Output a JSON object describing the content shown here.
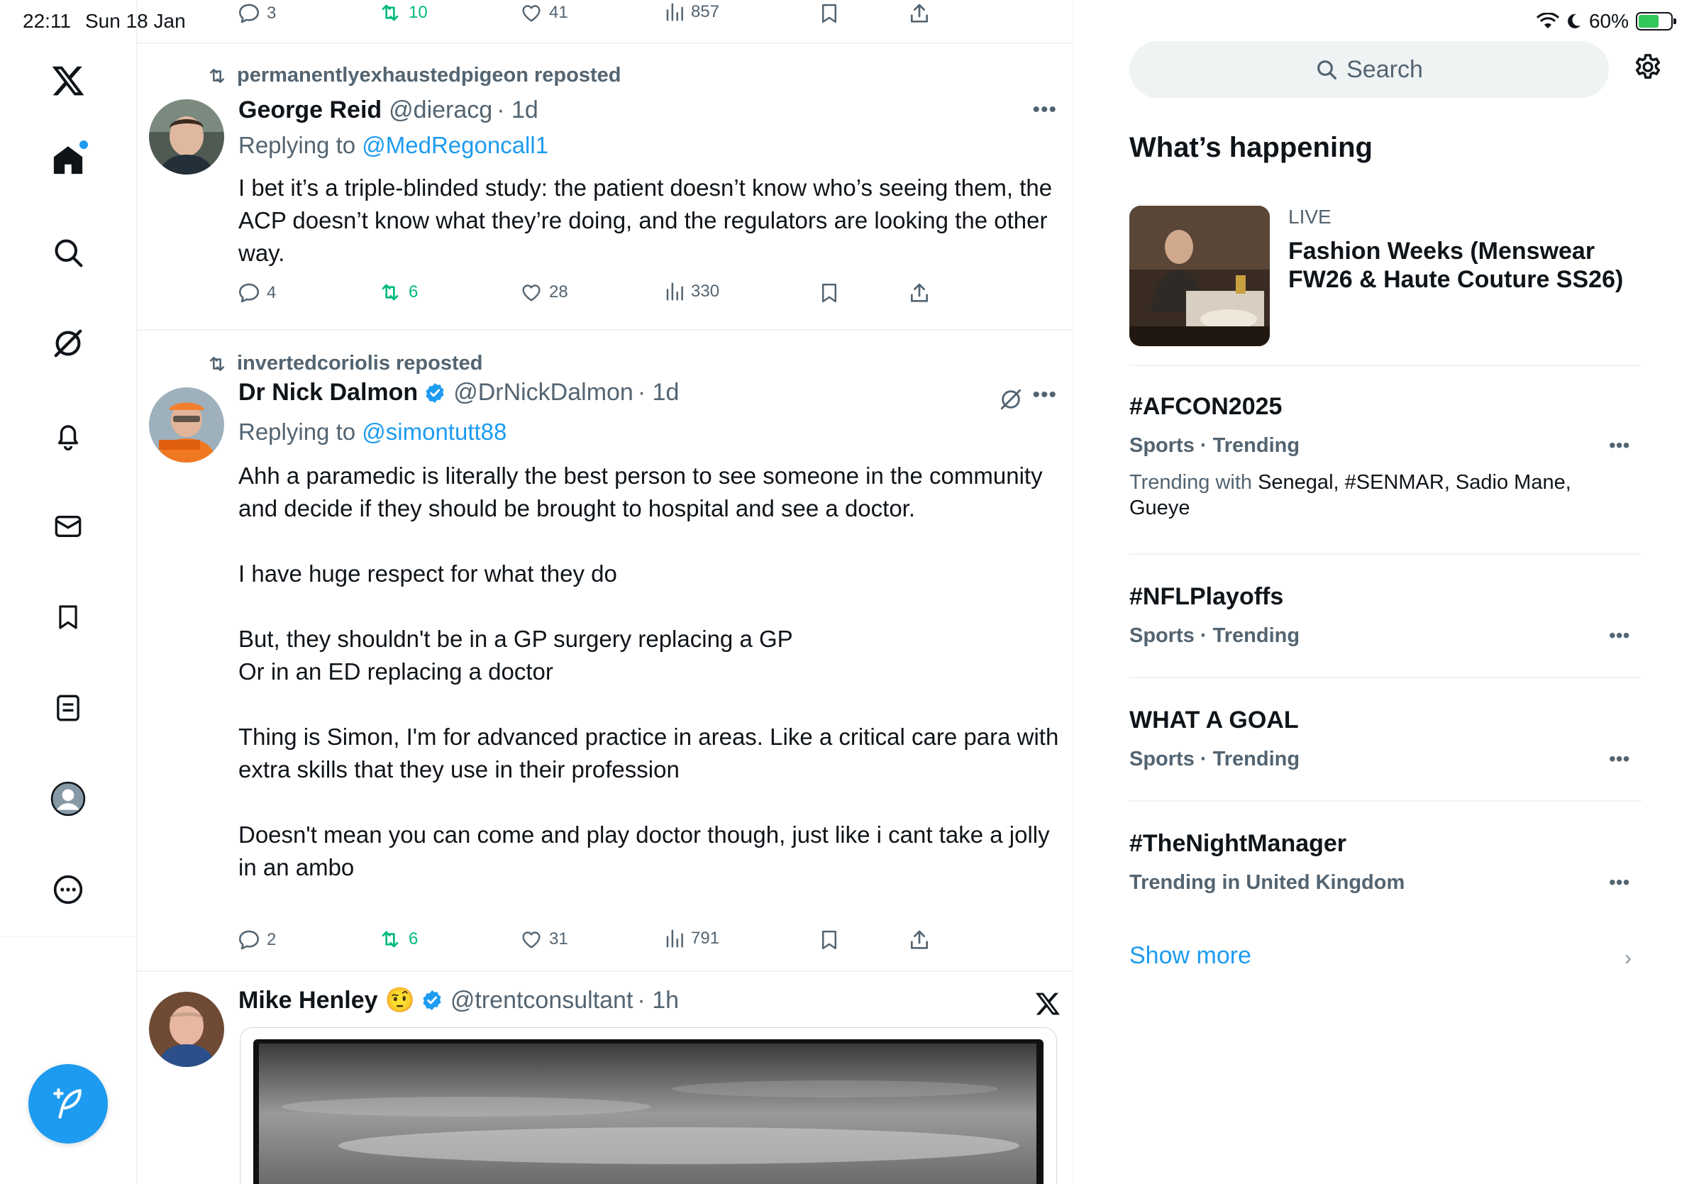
{
  "status_bar": {
    "time": "22:11",
    "date": "Sun 18 Jan",
    "battery": "60%",
    "battery_level": 0.6
  },
  "nav": {
    "items": [
      "x-logo",
      "home",
      "explore",
      "grok",
      "notifications",
      "messages",
      "bookmarks",
      "lists",
      "profile",
      "more"
    ],
    "compose": "compose"
  },
  "feed": {
    "top_tweet_actions": {
      "replies": "3",
      "reposts": "10",
      "likes": "41",
      "views": "857"
    },
    "tweets": [
      {
        "repost_by": "permanentlyexhaustedpigeon reposted",
        "name": "George Reid",
        "handle": "@dieracg",
        "time": "· 1d",
        "replying_prefix": "Replying to ",
        "replying_to": "@MedRegoncall1",
        "text": "I bet it’s a triple-blinded study: the patient doesn’t know who’s seeing them, the ACP doesn’t know what they’re doing, and the regulators are looking the other way.",
        "replies": "4",
        "reposts": "6",
        "likes": "28",
        "views": "330"
      },
      {
        "repost_by": "invertedcoriolis reposted",
        "name": "Dr Nick Dalmon",
        "handle": "@DrNickDalmon",
        "time": "· 1d",
        "replying_prefix": "Replying to ",
        "replying_to": "@simontutt88",
        "text": "Ahh a paramedic is literally the best person to see someone in the community and decide if they should be brought to hospital and see a doctor.\n\nI have huge respect for what they do\n\nBut, they shouldn't be in a GP surgery replacing a GP\nOr in an ED replacing a doctor\n\nThing is Simon, I'm for advanced practice in areas. Like a critical care para with extra skills that they use in their profession\n\nDoesn't mean you can come and play doctor though, just like i cant take a jolly in an ambo",
        "replies": "2",
        "reposts": "6",
        "likes": "31",
        "views": "791"
      },
      {
        "name": "Mike Henley",
        "emoji": "🤨",
        "handle": "@trentconsultant",
        "time": "· 1h"
      }
    ]
  },
  "sidebar": {
    "search_placeholder": "Search",
    "whats_happening": "What’s happening",
    "live": {
      "label": "LIVE",
      "title": "Fashion Weeks (Menswear FW26 & Haute Couture SS26)"
    },
    "trends": [
      {
        "name": "#AFCON2025",
        "meta": "Sports · Trending",
        "with_label": "Trending with ",
        "with": "Senegal, #SENMAR, Sadio Mane, Gueye"
      },
      {
        "name": "#NFLPlayoffs",
        "meta": "Sports · Trending"
      },
      {
        "name": "WHAT A GOAL",
        "meta": "Sports · Trending"
      },
      {
        "name": "#TheNightManager",
        "meta": "Trending in United Kingdom"
      }
    ],
    "show_more": "Show more"
  },
  "colors": {
    "accent": "#1d9bf0",
    "repost_green": "#00ba7c",
    "muted": "#536471",
    "text": "#0f1419"
  }
}
